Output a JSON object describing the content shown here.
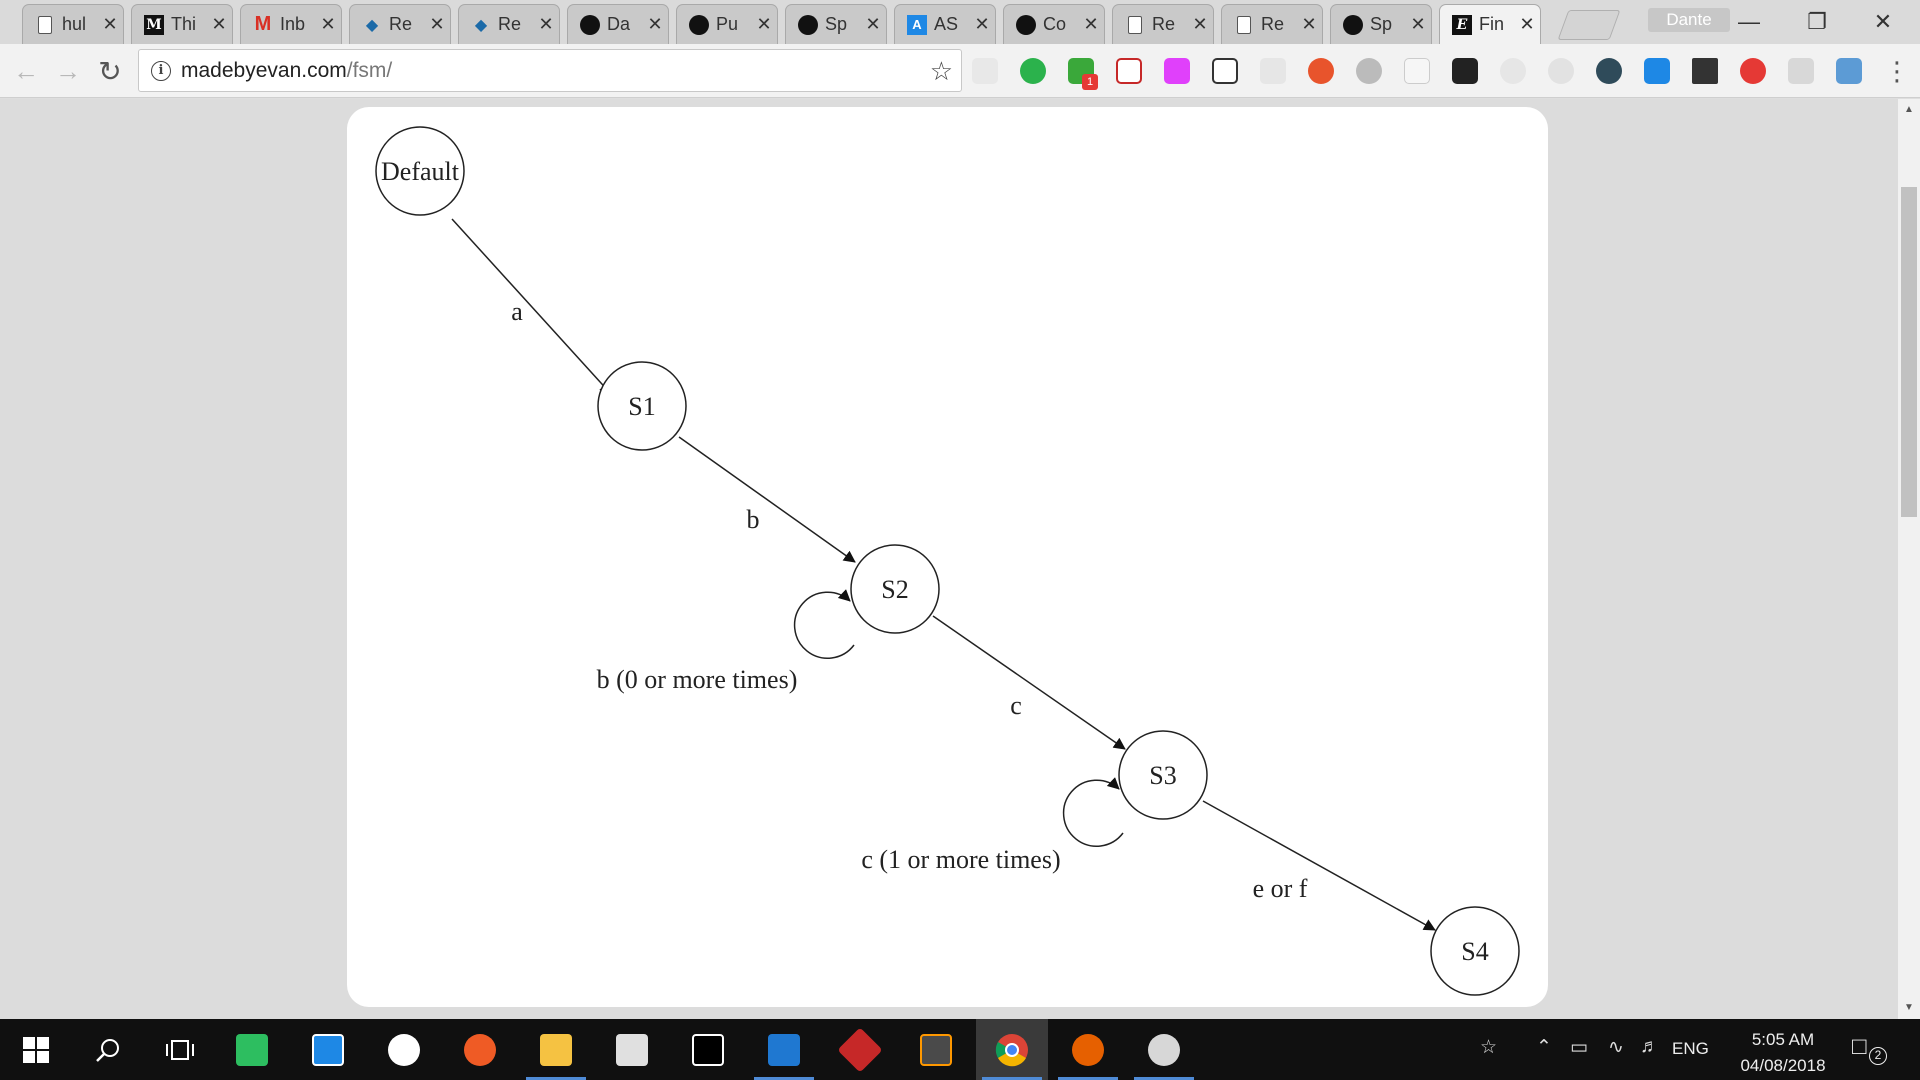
{
  "browser": {
    "tabs": [
      {
        "icon": "document-icon",
        "title": "hul"
      },
      {
        "icon": "medium-icon",
        "title": "Thi"
      },
      {
        "icon": "gmail-icon",
        "title": "Inb"
      },
      {
        "icon": "react-icon",
        "title": "Re"
      },
      {
        "icon": "react-icon",
        "title": "Re"
      },
      {
        "icon": "github-icon",
        "title": "Da"
      },
      {
        "icon": "github-icon",
        "title": "Pu"
      },
      {
        "icon": "github-icon",
        "title": "Sp"
      },
      {
        "icon": "as-icon",
        "title": "AS"
      },
      {
        "icon": "github-icon",
        "title": "Co"
      },
      {
        "icon": "document-icon",
        "title": "Re"
      },
      {
        "icon": "document-icon",
        "title": "Re"
      },
      {
        "icon": "github-icon",
        "title": "Sp"
      },
      {
        "icon": "e-icon",
        "title": "Fin",
        "active": true
      }
    ],
    "close_glyph": "✕",
    "profile_name": "Dante",
    "url_host": "madebyevan.com",
    "url_path": "/fsm/",
    "extension_badge": "1"
  },
  "fsm": {
    "states": [
      {
        "id": "default",
        "label": "Default"
      },
      {
        "id": "s1",
        "label": "S1"
      },
      {
        "id": "s2",
        "label": "S2"
      },
      {
        "id": "s3",
        "label": "S3"
      },
      {
        "id": "s4",
        "label": "S4"
      }
    ],
    "transitions": [
      {
        "from": "Default",
        "to": "S1",
        "label": "a"
      },
      {
        "from": "S1",
        "to": "S2",
        "label": "b"
      },
      {
        "from": "S2",
        "to": "S2",
        "label": "b (0 or more times)"
      },
      {
        "from": "S2",
        "to": "S3",
        "label": "c"
      },
      {
        "from": "S3",
        "to": "S3",
        "label": "c (1 or more times)"
      },
      {
        "from": "S3",
        "to": "S4",
        "label": "e or f"
      }
    ]
  },
  "taskbar": {
    "language": "ENG",
    "time": "5:05 AM",
    "date": "04/08/2018",
    "notification_count": "2"
  }
}
